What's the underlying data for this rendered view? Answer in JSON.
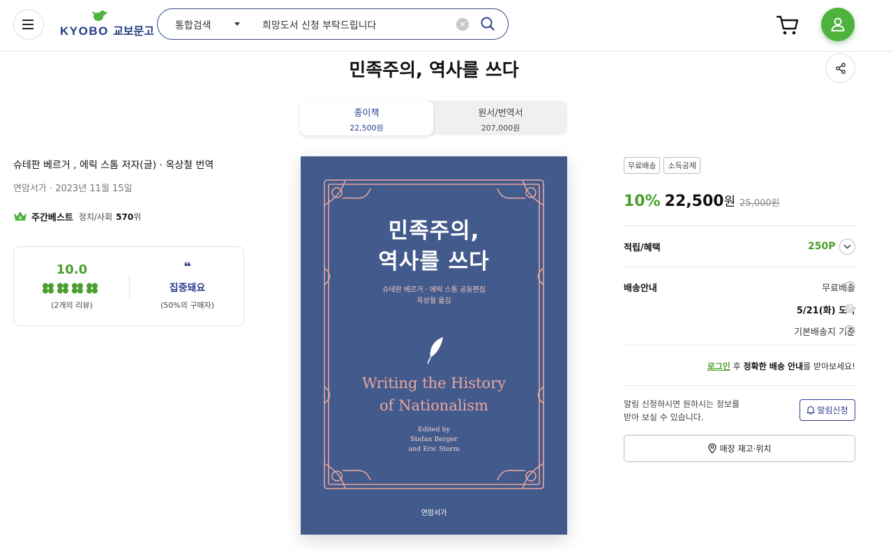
{
  "header": {
    "logo_text": "KYOBO",
    "logo_korean": "교보문고",
    "search_category": "통합검색",
    "search_query": "희망도서 신청 부탁드립니다"
  },
  "book": {
    "title": "민족주의, 역사를 쓰다",
    "authors": "슈테판 베르거 , 에릭 스톰 저자(글) · 옥상철 번역",
    "publisher_date": "연암서가 · 2023년 11월 15일",
    "bestseller": {
      "label": "주간베스트",
      "category": "정치/사회",
      "rank": "570",
      "rank_suffix": "위"
    }
  },
  "formats": [
    {
      "name": "종이책",
      "price": "22,500원"
    },
    {
      "name": "원서/번역서",
      "price": "207,000원"
    }
  ],
  "review": {
    "score": "10.0",
    "count": "(2개의 리뷰)",
    "keyword_quote": "❝",
    "keyword": "집중돼요",
    "keyword_share": "(50%의 구매자)"
  },
  "cover": {
    "korean_title_line1": "민족주의,",
    "korean_title_line2": "역사를 쓰다",
    "korean_editor_line1": "슈테판 베르거 · 에릭 스톰 공동편집",
    "korean_editor_line2": "옥상철 옮김",
    "english_title_line1": "Writing the History",
    "english_title_line2": "of Nationalism",
    "english_editor_line1": "Edited by",
    "english_editor_line2": "Stefan Berger",
    "english_editor_line3": "and Eric Storm",
    "publisher_mark": "연암서가"
  },
  "purchase": {
    "tags": [
      "무료배송",
      "소득공제"
    ],
    "discount": "10%",
    "price": "22,500",
    "price_unit": "원",
    "original_price": "25,000원",
    "benefit_label": "적립/혜택",
    "points": "250P",
    "shipping_label": "배송안내",
    "shipping_fee": "무료배송",
    "arrival": "5/21(화) 도착",
    "shipping_basis": "기본배송지 기준",
    "login_link": "로그인",
    "login_mid": " 후 ",
    "login_bold": "정확한 배송 안내",
    "login_tail": "를 받아보세요!",
    "alert_line1": "알림 신청하시면 원하시는 정보를",
    "alert_line2": "받아 보실 수 있습니다.",
    "alert_button": "알림신청",
    "store_button": "매장 재고·위치"
  },
  "colors": {
    "brand_green": "#4db33d",
    "brand_navy": "#2c3d8f",
    "cover_blue": "#435a8c",
    "cover_pink": "#eaa79c"
  }
}
